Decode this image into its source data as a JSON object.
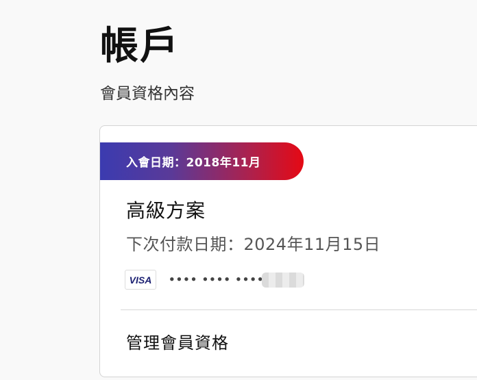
{
  "page": {
    "title": "帳戶",
    "subtitle": "會員資格內容"
  },
  "membership": {
    "member_since": "入會日期：2018年11月",
    "plan_name": "高級方案",
    "next_payment": "下次付款日期：2024年11月15日",
    "payment": {
      "card_brand": "VISA",
      "card_masked": "•••• •••• ••••"
    },
    "manage_label": "管理會員資格",
    "banner_colors": [
      "#3b3bb0",
      "#e50914"
    ]
  }
}
